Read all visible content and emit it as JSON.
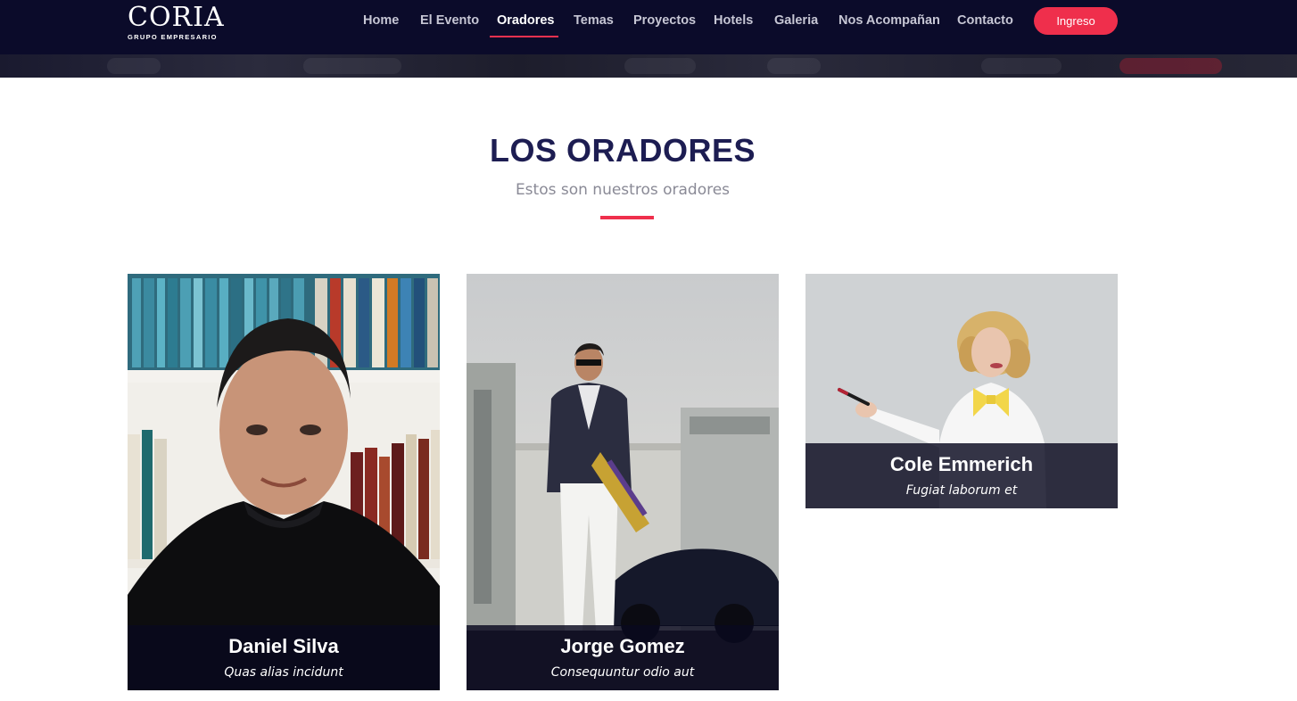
{
  "header": {
    "logo": {
      "name": "CORIA",
      "tagline": "GRUPO EMPRESARIO"
    },
    "nav": [
      {
        "label": "Home",
        "active": false
      },
      {
        "label": "El Evento",
        "active": false
      },
      {
        "label": "Oradores",
        "active": true
      },
      {
        "label": "Temas",
        "active": false
      },
      {
        "label": "Proyectos",
        "active": false
      },
      {
        "label": "Hotels",
        "active": false
      },
      {
        "label": "Galeria",
        "active": false
      },
      {
        "label": "Nos Acompañan",
        "active": false
      },
      {
        "label": "Contacto",
        "active": false
      }
    ],
    "cta_label": "Ingreso",
    "accent_color": "#ef2f4c",
    "background_color": "#0b0b2a"
  },
  "section": {
    "title": "LOS ORADORES",
    "subtitle": "Estos son nuestros oradores",
    "title_color": "#1d1d52"
  },
  "speakers": [
    {
      "name": "Daniel Silva",
      "role": "Quas alias incidunt",
      "photo": "portrait-man-bookshelf"
    },
    {
      "name": "Jorge Gomez",
      "role": "Consequuntur odio aut",
      "photo": "portrait-man-sports-car"
    },
    {
      "name": "Cole Emmerich",
      "role": "Fugiat laborum et",
      "photo": "portrait-woman-pointer"
    }
  ]
}
